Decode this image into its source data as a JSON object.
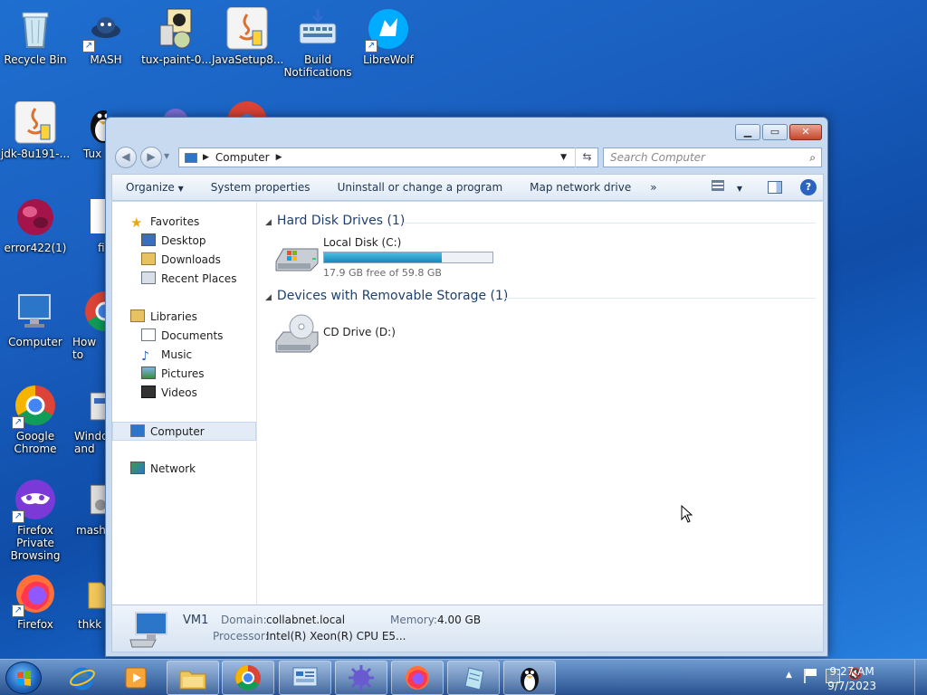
{
  "desktop": {
    "icons": [
      {
        "label": "Recycle Bin"
      },
      {
        "label": "MASH"
      },
      {
        "label": "tux-paint-0..."
      },
      {
        "label": "JavaSetup8..."
      },
      {
        "label": "Build Notifications"
      },
      {
        "label": "LibreWolf"
      },
      {
        "label": "jdk-8u191-..."
      },
      {
        "label": "Tux"
      },
      {
        "label": "error422(1)"
      },
      {
        "label": "fi"
      },
      {
        "label": "Computer"
      },
      {
        "label": "How to"
      },
      {
        "label": "Google Chrome"
      },
      {
        "label": "Windo and"
      },
      {
        "label": "Firefox Private Browsing"
      },
      {
        "label": "mash"
      },
      {
        "label": "Firefox"
      },
      {
        "label": "thkk"
      }
    ]
  },
  "window": {
    "address": {
      "segments": [
        "Computer"
      ],
      "search_placeholder": "Search Computer"
    },
    "toolbar": {
      "organize": "Organize",
      "system_properties": "System properties",
      "uninstall": "Uninstall or change a program",
      "map_drive": "Map network drive",
      "more": "»"
    },
    "nav": {
      "favorites": "Favorites",
      "desktop": "Desktop",
      "downloads": "Downloads",
      "recent": "Recent Places",
      "libraries": "Libraries",
      "documents": "Documents",
      "music": "Music",
      "pictures": "Pictures",
      "videos": "Videos",
      "computer": "Computer",
      "network": "Network"
    },
    "groups": {
      "hdd_title": "Hard Disk Drives (1)",
      "removable_title": "Devices with Removable Storage (1)"
    },
    "drives": {
      "c_name": "Local Disk (C:)",
      "c_free_text": "17.9 GB free of 59.8 GB",
      "c_used_fraction": 0.7,
      "d_name": "CD Drive (D:)"
    },
    "details": {
      "pc_name": "VM1",
      "domain_label": "Domain:",
      "domain_value": "collabnet.local",
      "memory_label": "Memory:",
      "memory_value": "4.00 GB",
      "processor_label": "Processor:",
      "processor_value": "Intel(R) Xeon(R) CPU E5..."
    }
  },
  "taskbar": {
    "time": "9:27 AM",
    "date": "9/7/2023"
  },
  "colors": {
    "accent": "#1a5fc0",
    "meter_fill": "#1b86b8"
  }
}
